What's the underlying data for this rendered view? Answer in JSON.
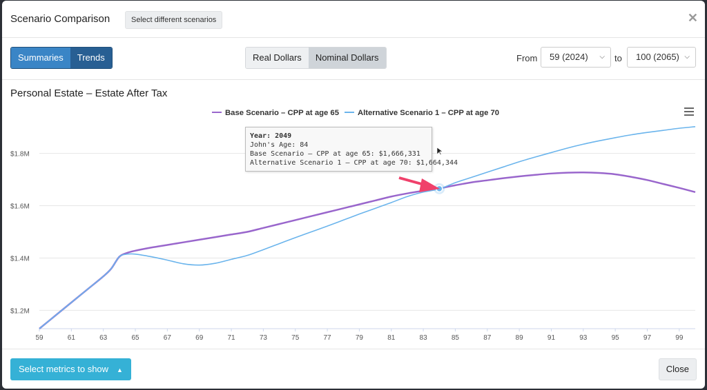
{
  "header": {
    "title": "Scenario Comparison",
    "select_button": "Select different scenarios",
    "close_icon": "close-icon"
  },
  "toolbar": {
    "view_tabs": [
      "Summaries",
      "Trends"
    ],
    "dollar_tabs": [
      "Real Dollars",
      "Nominal Dollars"
    ],
    "from_label": "From",
    "from_value": "59 (2024)",
    "to_label": "to",
    "to_value": "100 (2065)"
  },
  "footer": {
    "metrics_button": "Select metrics to show",
    "close_button": "Close"
  },
  "colors": {
    "base": "#9966cc",
    "alt": "#6ab4ec",
    "accent": "#3a85c6",
    "arrow": "#f0416b"
  },
  "tooltip": {
    "year": "Year: 2049",
    "age": "John's Age: 84",
    "base": "Base Scenario – CPP at age 65: $1,666,331",
    "alt": "Alternative Scenario 1 – CPP at age 70: $1,664,344"
  },
  "chart_data": {
    "type": "line",
    "title": "Personal Estate – Estate After Tax",
    "xlim": [
      59,
      100
    ],
    "ylim": [
      1.13,
      1.92
    ],
    "x_ticks": [
      59,
      61,
      63,
      65,
      67,
      69,
      71,
      73,
      75,
      77,
      79,
      81,
      83,
      85,
      87,
      89,
      91,
      93,
      95,
      97,
      99
    ],
    "y_ticks": [
      {
        "value": 1.2,
        "label": "$1.2M"
      },
      {
        "value": 1.4,
        "label": "$1.4M"
      },
      {
        "value": 1.6,
        "label": "$1.6M"
      },
      {
        "value": 1.8,
        "label": "$1.8M"
      }
    ],
    "highlight": {
      "x": 84,
      "y": 1.665
    },
    "series": [
      {
        "name": "Base Scenario - CPP at age 65",
        "x": [
          59,
          60,
          61,
          62,
          63,
          63.5,
          64,
          64.5,
          65,
          66,
          67,
          68,
          69,
          70,
          71,
          72,
          73,
          74,
          75,
          76,
          77,
          78,
          79,
          80,
          81,
          82,
          83,
          84,
          85,
          86,
          87,
          88,
          89,
          90,
          91,
          92,
          93,
          94,
          95,
          96,
          97,
          98,
          99,
          100
        ],
        "y": [
          1.13,
          1.18,
          1.23,
          1.28,
          1.33,
          1.36,
          1.405,
          1.42,
          1.428,
          1.44,
          1.45,
          1.46,
          1.47,
          1.48,
          1.49,
          1.5,
          1.515,
          1.53,
          1.545,
          1.56,
          1.575,
          1.59,
          1.605,
          1.62,
          1.635,
          1.647,
          1.657,
          1.666,
          1.678,
          1.689,
          1.697,
          1.705,
          1.712,
          1.718,
          1.723,
          1.726,
          1.727,
          1.725,
          1.72,
          1.71,
          1.698,
          1.683,
          1.668,
          1.652
        ]
      },
      {
        "name": "Alternative Scenario 1 - CPP at age 70",
        "x": [
          59,
          60,
          61,
          62,
          63,
          63.5,
          64,
          64.5,
          65,
          66,
          67,
          68,
          69,
          70,
          71,
          72,
          73,
          74,
          75,
          76,
          77,
          78,
          79,
          80,
          81,
          82,
          83,
          84,
          85,
          86,
          87,
          88,
          89,
          90,
          91,
          92,
          93,
          94,
          95,
          96,
          97,
          98,
          99,
          100
        ],
        "y": [
          1.13,
          1.18,
          1.23,
          1.28,
          1.33,
          1.36,
          1.405,
          1.415,
          1.415,
          1.405,
          1.392,
          1.378,
          1.373,
          1.38,
          1.395,
          1.41,
          1.432,
          1.455,
          1.478,
          1.5,
          1.522,
          1.545,
          1.568,
          1.59,
          1.612,
          1.635,
          1.652,
          1.664,
          1.688,
          1.708,
          1.728,
          1.748,
          1.768,
          1.786,
          1.803,
          1.82,
          1.835,
          1.848,
          1.86,
          1.871,
          1.88,
          1.888,
          1.896,
          1.902
        ]
      }
    ]
  }
}
